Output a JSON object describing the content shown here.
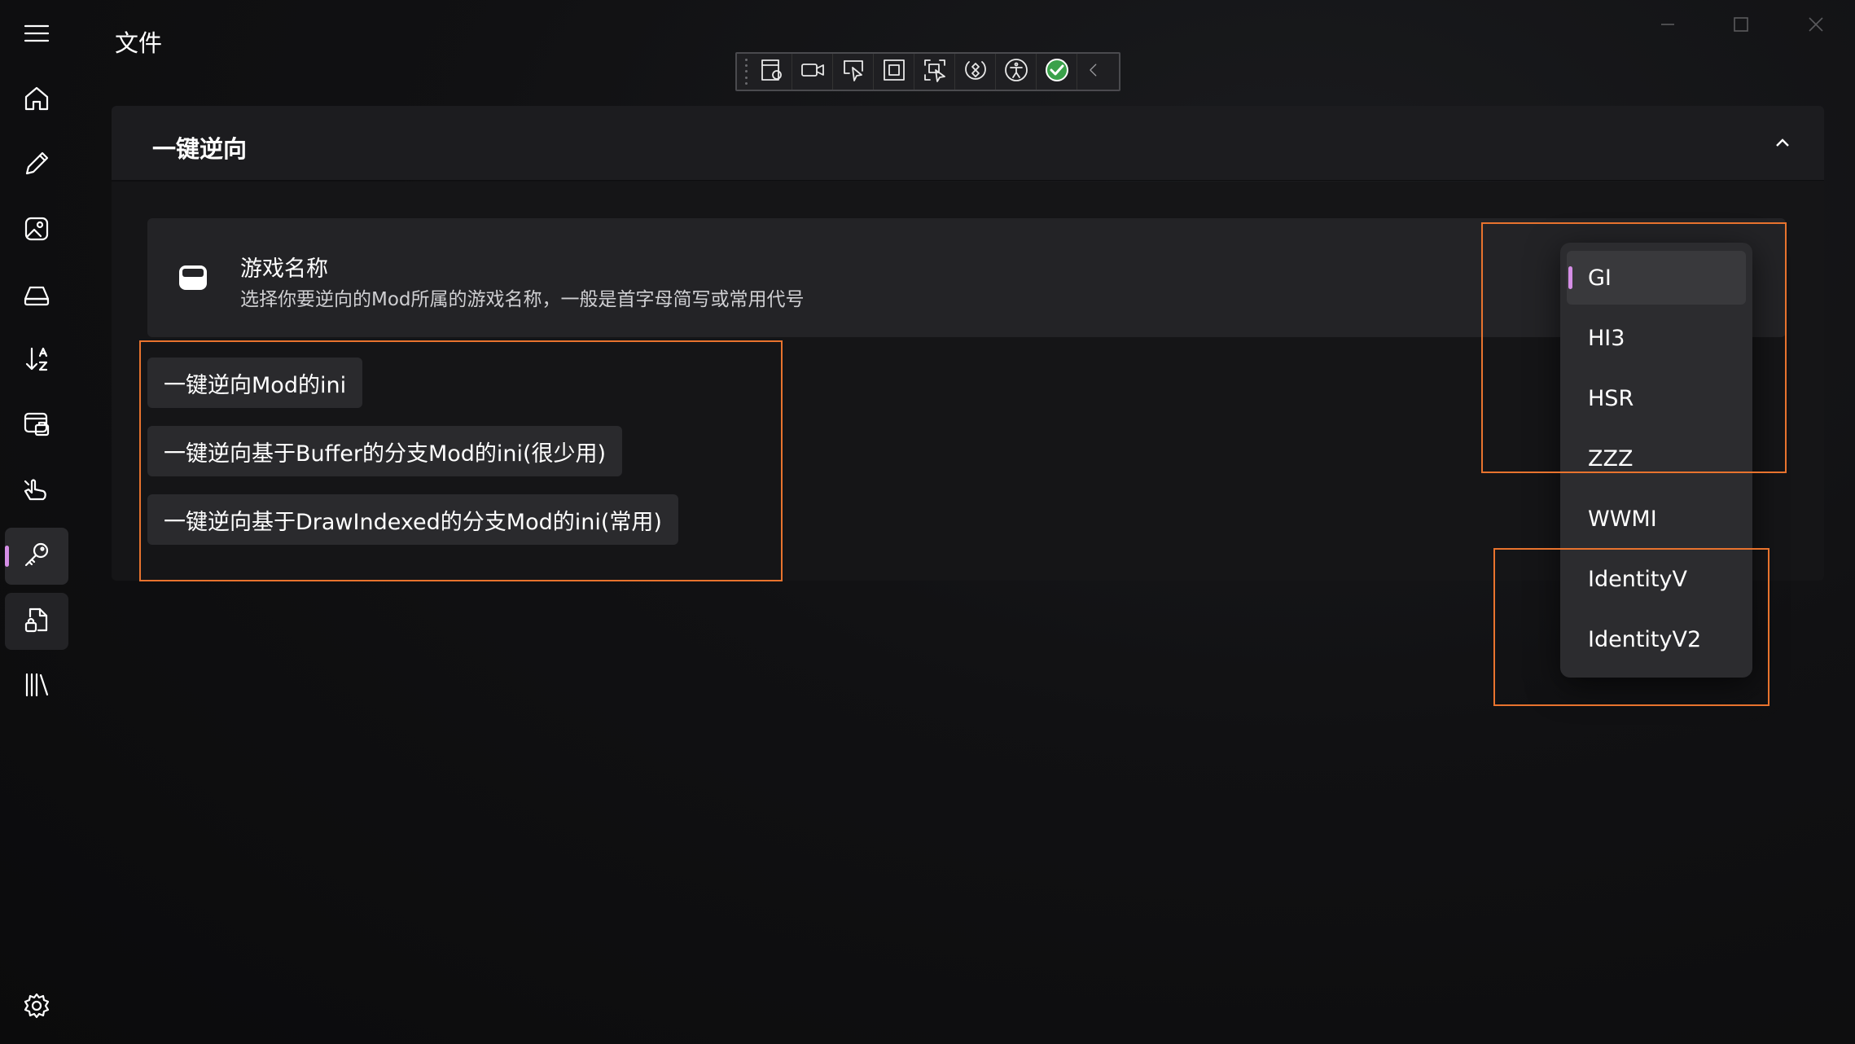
{
  "app": {
    "title": "文件"
  },
  "sidebar": {
    "items": [
      {
        "name": "menu",
        "icon": "hamburger-menu-icon"
      },
      {
        "name": "home",
        "icon": "home-icon"
      },
      {
        "name": "edit",
        "icon": "pencil-icon"
      },
      {
        "name": "image",
        "icon": "image-edit-icon"
      },
      {
        "name": "drive",
        "icon": "drive-icon"
      },
      {
        "name": "sort",
        "icon": "sort-icon"
      },
      {
        "name": "briefcase-window",
        "icon": "window-briefcase-icon"
      },
      {
        "name": "touch",
        "icon": "hand-pointer-icon"
      },
      {
        "name": "key",
        "icon": "key-icon",
        "selected": true
      },
      {
        "name": "document-lock",
        "icon": "document-lock-icon"
      },
      {
        "name": "library",
        "icon": "library-icon"
      },
      {
        "name": "settings",
        "icon": "settings-gear-icon"
      }
    ],
    "accent": "#d58ee6"
  },
  "toolbar": {
    "buttons": [
      "live-visual-tree-icon",
      "record-icon",
      "select-element-icon",
      "display-layout-adorners-icon",
      "track-focus-icon",
      "hot-reload-icon",
      "accessibility-icon",
      "binding-ok-icon",
      "collapse-icon"
    ]
  },
  "expander": {
    "title": "一键逆向"
  },
  "setting": {
    "title": "游戏名称",
    "description": "选择你要逆向的Mod所属的游戏名称，一般是首字母简写或常用代号"
  },
  "actions": [
    {
      "label": "一键逆向Mod的ini"
    },
    {
      "label": "一键逆向基于Buffer的分支Mod的ini(很少用)"
    },
    {
      "label": "一键逆向基于DrawIndexed的分支Mod的ini(常用)"
    }
  ],
  "dropdown": {
    "selected": "GI",
    "options": [
      "GI",
      "HI3",
      "HSR",
      "ZZZ",
      "WWMI",
      "IdentityV",
      "IdentityV2"
    ]
  },
  "colors": {
    "accent": "#d58ee6",
    "annotation": "#e8732e",
    "background": "#0d0d0e",
    "card": "#232326"
  }
}
